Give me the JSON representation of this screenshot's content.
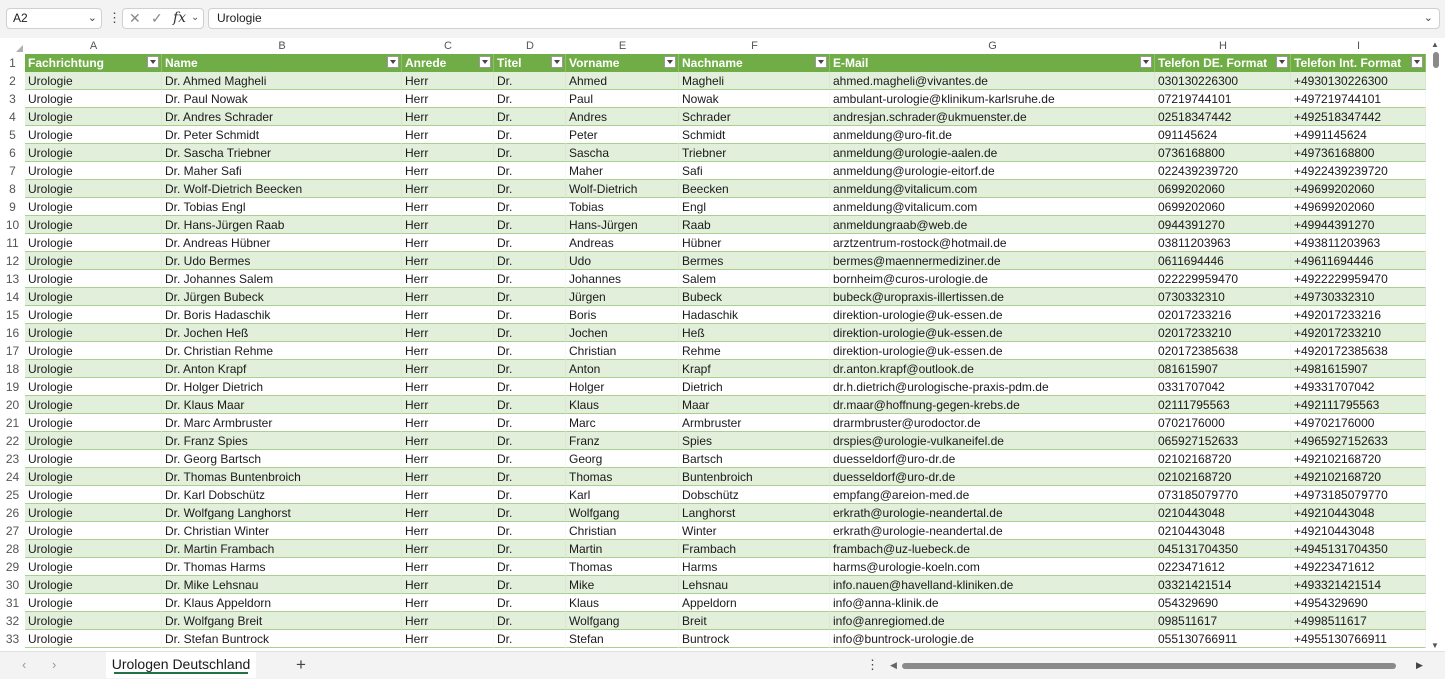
{
  "formula_bar": {
    "name_box": "A2",
    "cancel_symbol": "✕",
    "enter_symbol": "✓",
    "fx_label": "fx",
    "content": "Urologie"
  },
  "columns": [
    "A",
    "B",
    "C",
    "D",
    "E",
    "F",
    "G",
    "H",
    "I"
  ],
  "headers": [
    "Fachrichtung",
    "Name",
    "Anrede",
    "Titel",
    "Vorname",
    "Nachname",
    "E-Mail",
    "Telefon DE. Format",
    "Telefon Int. Format"
  ],
  "rows": [
    [
      "Urologie",
      "Dr. Ahmed Magheli",
      "Herr",
      "Dr.",
      "Ahmed",
      "Magheli",
      "ahmed.magheli@vivantes.de",
      "030130226300",
      "+4930130226300"
    ],
    [
      "Urologie",
      "Dr. Paul Nowak",
      "Herr",
      "Dr.",
      "Paul",
      "Nowak",
      "ambulant-urologie@klinikum-karlsruhe.de",
      "07219744101",
      "+497219744101"
    ],
    [
      "Urologie",
      "Dr. Andres Schrader",
      "Herr",
      "Dr.",
      "Andres",
      "Schrader",
      "andresjan.schrader@ukmuenster.de",
      "02518347442",
      "+492518347442"
    ],
    [
      "Urologie",
      "Dr. Peter Schmidt",
      "Herr",
      "Dr.",
      "Peter",
      "Schmidt",
      "anmeldung@uro-fit.de",
      "091145624",
      "+4991145624"
    ],
    [
      "Urologie",
      "Dr. Sascha Triebner",
      "Herr",
      "Dr.",
      "Sascha",
      "Triebner",
      "anmeldung@urologie-aalen.de",
      "0736168800",
      "+49736168800"
    ],
    [
      "Urologie",
      "Dr. Maher Safi",
      "Herr",
      "Dr.",
      "Maher",
      "Safi",
      "anmeldung@urologie-eitorf.de",
      "022439239720",
      "+4922439239720"
    ],
    [
      "Urologie",
      "Dr. Wolf-Dietrich Beecken",
      "Herr",
      "Dr.",
      "Wolf-Dietrich",
      "Beecken",
      "anmeldung@vitalicum.com",
      "0699202060",
      "+49699202060"
    ],
    [
      "Urologie",
      "Dr. Tobias Engl",
      "Herr",
      "Dr.",
      "Tobias",
      "Engl",
      "anmeldung@vitalicum.com",
      "0699202060",
      "+49699202060"
    ],
    [
      "Urologie",
      "Dr. Hans-Jürgen Raab",
      "Herr",
      "Dr.",
      "Hans-Jürgen",
      "Raab",
      "anmeldungraab@web.de",
      "0944391270",
      "+49944391270"
    ],
    [
      "Urologie",
      "Dr. Andreas Hübner",
      "Herr",
      "Dr.",
      "Andreas",
      "Hübner",
      "arztzentrum-rostock@hotmail.de",
      "03811203963",
      "+493811203963"
    ],
    [
      "Urologie",
      "Dr. Udo Bermes",
      "Herr",
      "Dr.",
      "Udo",
      "Bermes",
      "bermes@maennermediziner.de",
      "0611694446",
      "+49611694446"
    ],
    [
      "Urologie",
      "Dr. Johannes Salem",
      "Herr",
      "Dr.",
      "Johannes",
      "Salem",
      "bornheim@curos-urologie.de",
      "022229959470",
      "+4922229959470"
    ],
    [
      "Urologie",
      "Dr. Jürgen Bubeck",
      "Herr",
      "Dr.",
      "Jürgen",
      "Bubeck",
      "bubeck@uropraxis-illertissen.de",
      "0730332310",
      "+49730332310"
    ],
    [
      "Urologie",
      "Dr. Boris Hadaschik",
      "Herr",
      "Dr.",
      "Boris",
      "Hadaschik",
      "direktion-urologie@uk-essen.de",
      "02017233216",
      "+492017233216"
    ],
    [
      "Urologie",
      "Dr. Jochen Heß",
      "Herr",
      "Dr.",
      "Jochen",
      "Heß",
      "direktion-urologie@uk-essen.de",
      "02017233210",
      "+492017233210"
    ],
    [
      "Urologie",
      "Dr. Christian Rehme",
      "Herr",
      "Dr.",
      "Christian",
      "Rehme",
      "direktion-urologie@uk-essen.de",
      "020172385638",
      "+4920172385638"
    ],
    [
      "Urologie",
      "Dr. Anton Krapf",
      "Herr",
      "Dr.",
      "Anton",
      "Krapf",
      "dr.anton.krapf@outlook.de",
      "081615907",
      "+4981615907"
    ],
    [
      "Urologie",
      "Dr. Holger Dietrich",
      "Herr",
      "Dr.",
      "Holger",
      "Dietrich",
      "dr.h.dietrich@urologische-praxis-pdm.de",
      "0331707042",
      "+49331707042"
    ],
    [
      "Urologie",
      "Dr. Klaus Maar",
      "Herr",
      "Dr.",
      "Klaus",
      "Maar",
      "dr.maar@hoffnung-gegen-krebs.de",
      "02111795563",
      "+492111795563"
    ],
    [
      "Urologie",
      "Dr. Marc Armbruster",
      "Herr",
      "Dr.",
      "Marc",
      "Armbruster",
      "drarmbruster@urodoctor.de",
      "0702176000",
      "+49702176000"
    ],
    [
      "Urologie",
      "Dr. Franz Spies",
      "Herr",
      "Dr.",
      "Franz",
      "Spies",
      "drspies@urologie-vulkaneifel.de",
      "065927152633",
      "+4965927152633"
    ],
    [
      "Urologie",
      "Dr. Georg Bartsch",
      "Herr",
      "Dr.",
      "Georg",
      "Bartsch",
      "duesseldorf@uro-dr.de",
      "02102168720",
      "+492102168720"
    ],
    [
      "Urologie",
      "Dr. Thomas Buntenbroich",
      "Herr",
      "Dr.",
      "Thomas",
      "Buntenbroich",
      "duesseldorf@uro-dr.de",
      "02102168720",
      "+492102168720"
    ],
    [
      "Urologie",
      "Dr. Karl Dobschütz",
      "Herr",
      "Dr.",
      "Karl",
      "Dobschütz",
      "empfang@areion-med.de",
      "073185079770",
      "+4973185079770"
    ],
    [
      "Urologie",
      "Dr. Wolfgang Langhorst",
      "Herr",
      "Dr.",
      "Wolfgang",
      "Langhorst",
      "erkrath@urologie-neandertal.de",
      "0210443048",
      "+49210443048"
    ],
    [
      "Urologie",
      "Dr. Christian Winter",
      "Herr",
      "Dr.",
      "Christian",
      "Winter",
      "erkrath@urologie-neandertal.de",
      "0210443048",
      "+49210443048"
    ],
    [
      "Urologie",
      "Dr. Martin Frambach",
      "Herr",
      "Dr.",
      "Martin",
      "Frambach",
      "frambach@uz-luebeck.de",
      "045131704350",
      "+4945131704350"
    ],
    [
      "Urologie",
      "Dr. Thomas Harms",
      "Herr",
      "Dr.",
      "Thomas",
      "Harms",
      "harms@urologie-koeln.com",
      "0223471612",
      "+49223471612"
    ],
    [
      "Urologie",
      "Dr. Mike Lehsnau",
      "Herr",
      "Dr.",
      "Mike",
      "Lehsnau",
      "info.nauen@havelland-kliniken.de",
      "03321421514",
      "+493321421514"
    ],
    [
      "Urologie",
      "Dr. Klaus Appeldorn",
      "Herr",
      "Dr.",
      "Klaus",
      "Appeldorn",
      "info@anna-klinik.de",
      "054329690",
      "+4954329690"
    ],
    [
      "Urologie",
      "Dr. Wolfgang Breit",
      "Herr",
      "Dr.",
      "Wolfgang",
      "Breit",
      "info@anregiomed.de",
      "098511617",
      "+4998511617"
    ],
    [
      "Urologie",
      "Dr. Stefan Buntrock",
      "Herr",
      "Dr.",
      "Stefan",
      "Buntrock",
      "info@buntrock-urologie.de",
      "055130766911",
      "+4955130766911"
    ]
  ],
  "sheet_tab": "Urologen Deutschland",
  "add_sheet_symbol": "+",
  "colors": {
    "header_fill": "#70ad47",
    "band_fill": "#e2efda",
    "border": "#a9d08e",
    "tab_underline": "#217346"
  }
}
